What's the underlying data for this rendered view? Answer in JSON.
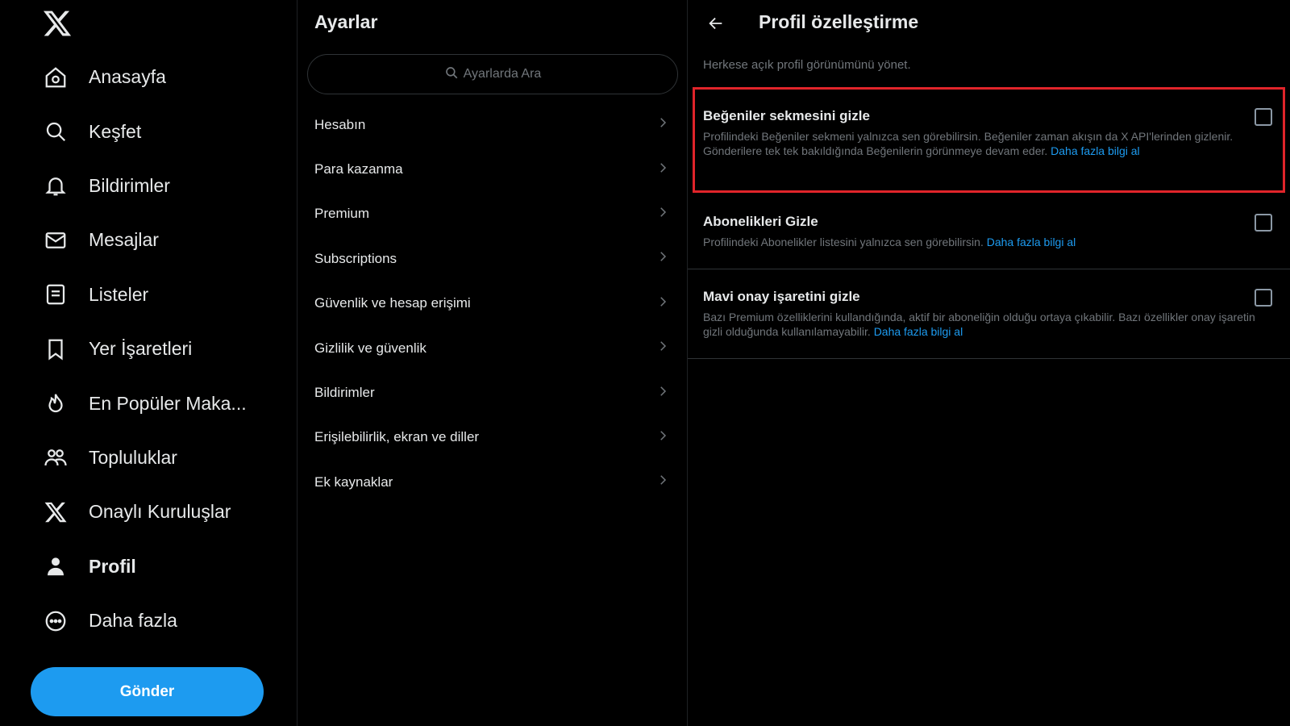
{
  "sidebar": {
    "items": [
      {
        "label": "Anasayfa",
        "icon": "home-icon"
      },
      {
        "label": "Keşfet",
        "icon": "search-icon"
      },
      {
        "label": "Bildirimler",
        "icon": "bell-icon"
      },
      {
        "label": "Mesajlar",
        "icon": "mail-icon"
      },
      {
        "label": "Listeler",
        "icon": "list-icon"
      },
      {
        "label": "Yer İşaretleri",
        "icon": "bookmark-icon"
      },
      {
        "label": "En Popüler Maka...",
        "icon": "flame-icon"
      },
      {
        "label": "Topluluklar",
        "icon": "communities-icon"
      },
      {
        "label": "Onaylı Kuruluşlar",
        "icon": "x-logo-icon"
      },
      {
        "label": "Profil",
        "icon": "person-icon"
      },
      {
        "label": "Daha fazla",
        "icon": "more-circle-icon"
      }
    ],
    "post_button": "Gönder"
  },
  "settings": {
    "title": "Ayarlar",
    "search_placeholder": "Ayarlarda Ara",
    "items": [
      "Hesabın",
      "Para kazanma",
      "Premium",
      "Subscriptions",
      "Güvenlik ve hesap erişimi",
      "Gizlilik ve güvenlik",
      "Bildirimler",
      "Erişilebilirlik, ekran ve diller",
      "Ek kaynaklar"
    ]
  },
  "profile": {
    "title": "Profil özelleştirme",
    "subtitle": "Herkese açık profil görünümünü yönet.",
    "options": [
      {
        "title": "Beğeniler sekmesini gizle",
        "desc": "Profilindeki Beğeniler sekmeni yalnızca sen görebilirsin. Beğeniler zaman akışın da X API'lerinden gizlenir. Gönderilere tek tek bakıldığında Beğenilerin görünmeye devam eder.",
        "link": "Daha fazla bilgi al"
      },
      {
        "title": "Abonelikleri Gizle",
        "desc": "Profilindeki Abonelikler listesini yalnızca sen görebilirsin.",
        "link": "Daha fazla bilgi al"
      },
      {
        "title": "Mavi onay işaretini gizle",
        "desc": "Bazı Premium özelliklerini kullandığında, aktif bir aboneliğin olduğu ortaya çıkabilir. Bazı özellikler onay işaretin gizli olduğunda kullanılamayabilir.",
        "link": "Daha fazla bilgi al"
      }
    ]
  },
  "colors": {
    "accent": "#1d9bf0",
    "highlight": "#e0242a",
    "background": "#000000"
  }
}
